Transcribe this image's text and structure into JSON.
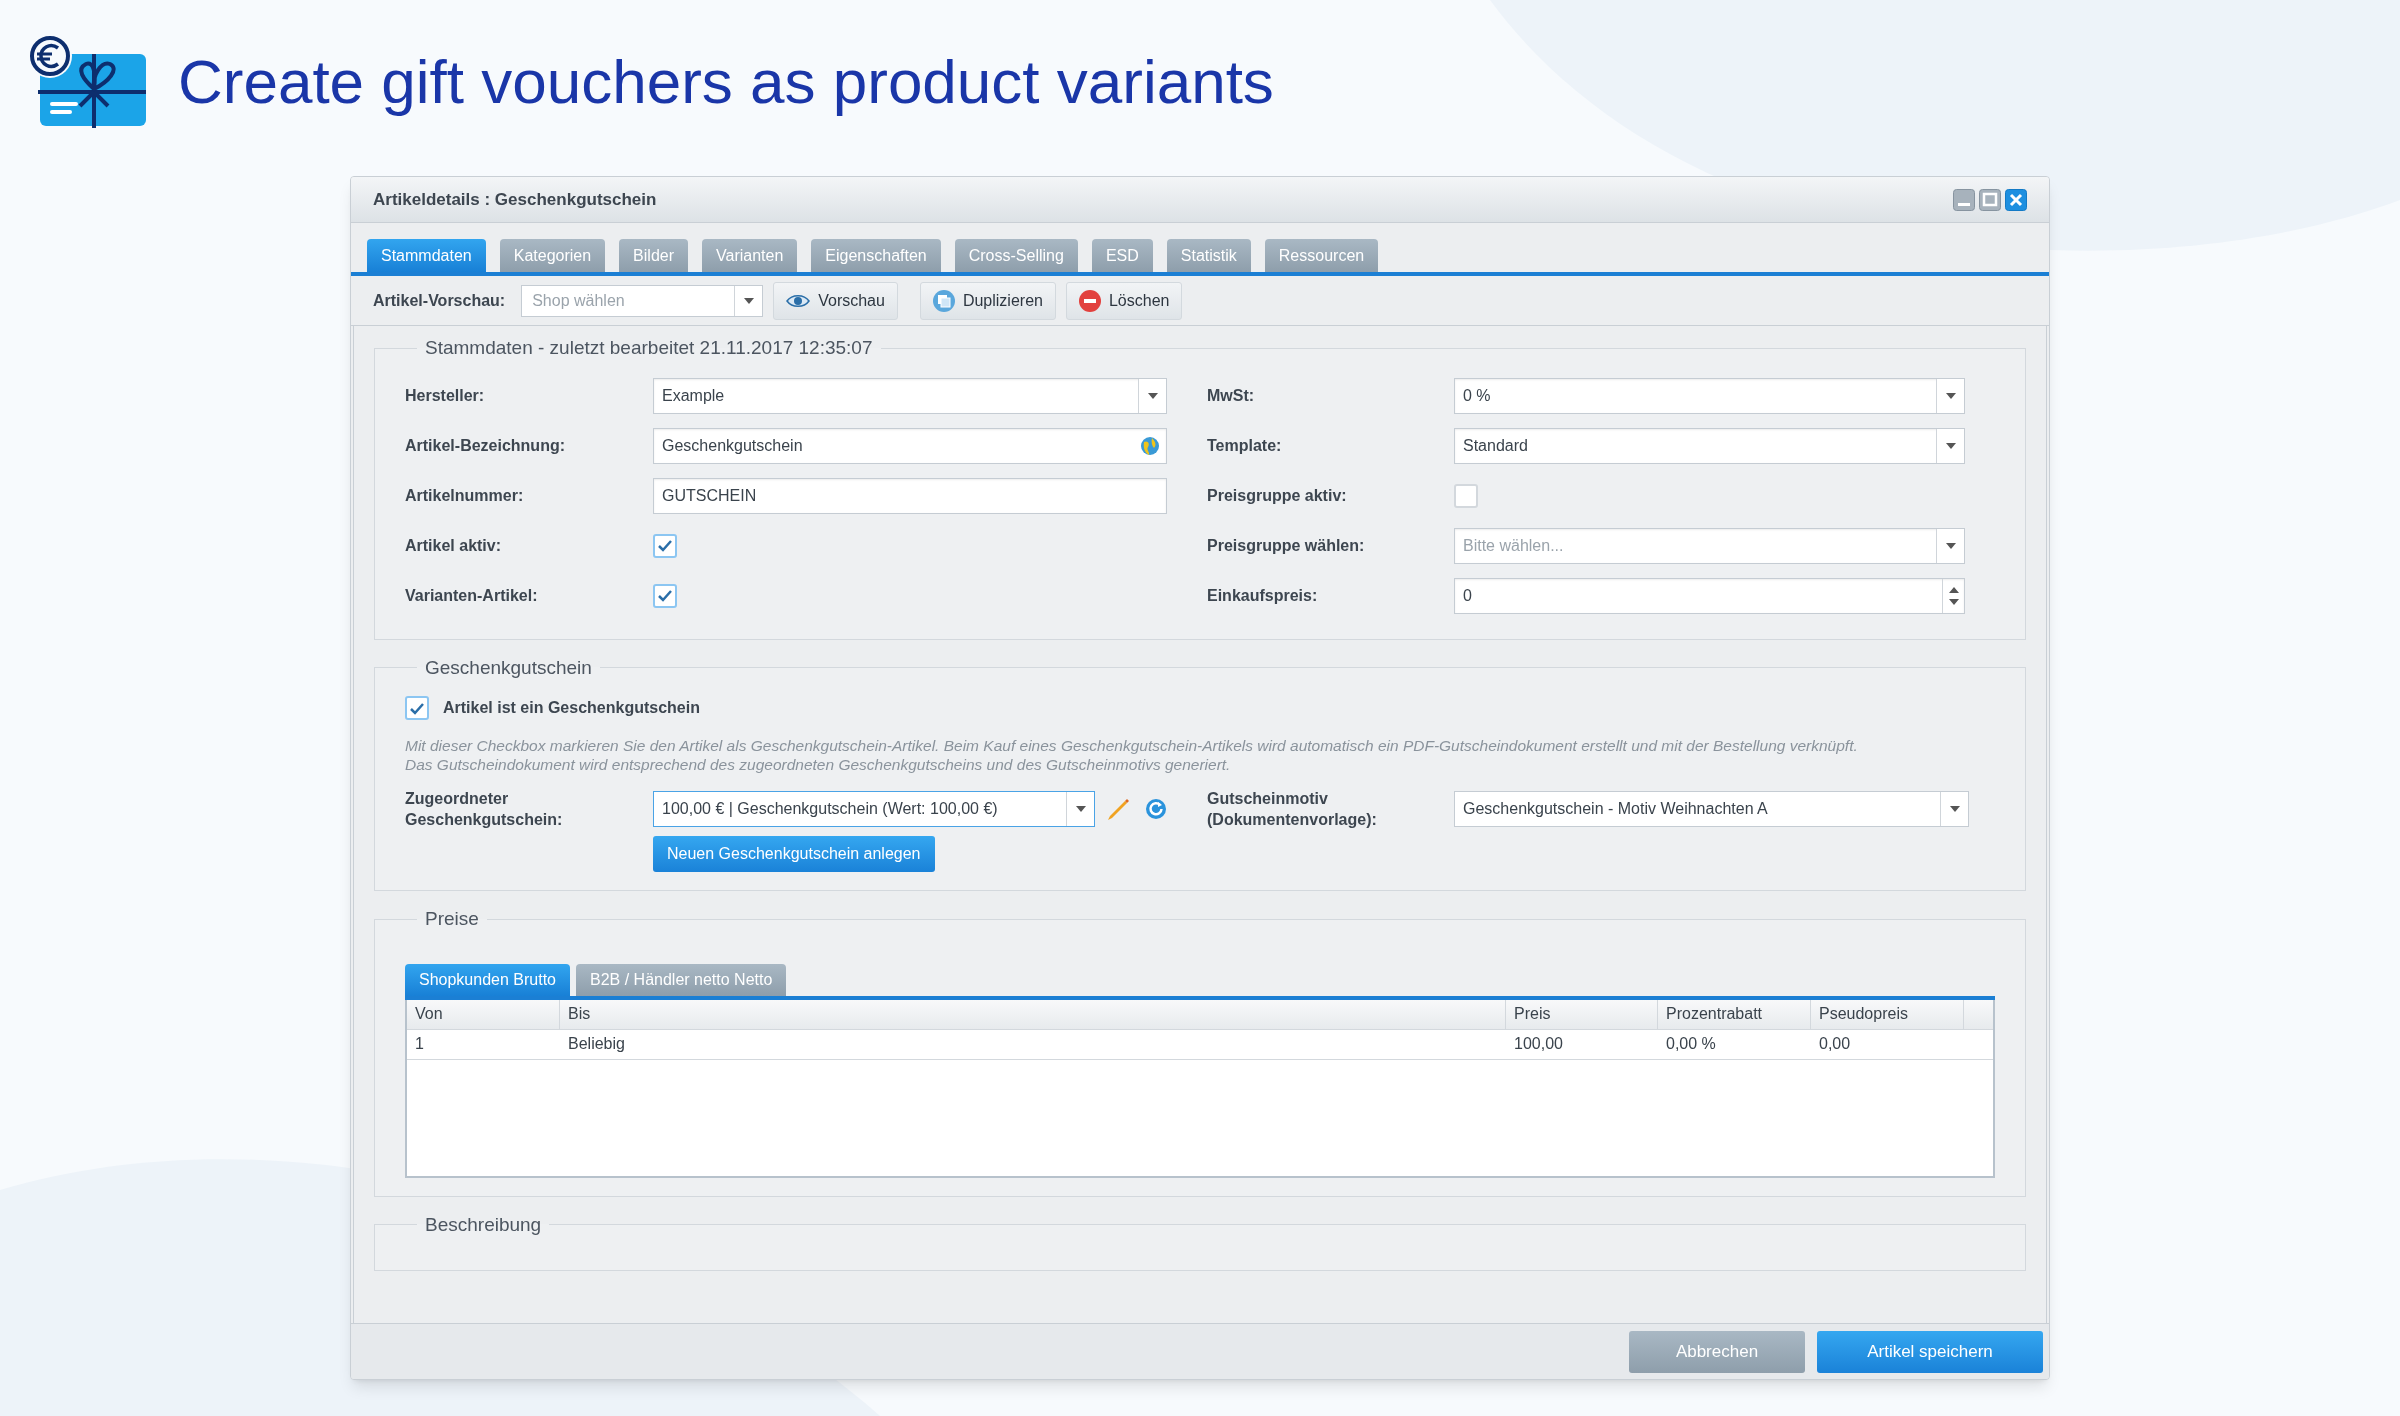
{
  "headline": {
    "title": "Create gift vouchers as product variants"
  },
  "window": {
    "title": "Artikeldetails : Geschenkgutschein"
  },
  "tabs": [
    {
      "label": "Stammdaten",
      "selected": true
    },
    {
      "label": "Kategorien",
      "selected": false
    },
    {
      "label": "Bilder",
      "selected": false
    },
    {
      "label": "Varianten",
      "selected": false
    },
    {
      "label": "Eigenschaften",
      "selected": false
    },
    {
      "label": "Cross-Selling",
      "selected": false
    },
    {
      "label": "ESD",
      "selected": false
    },
    {
      "label": "Statistik",
      "selected": false
    },
    {
      "label": "Ressourcen",
      "selected": false
    }
  ],
  "toolbar": {
    "label": "Artikel-Vorschau:",
    "shop_select": {
      "placeholder": "Shop wählen"
    },
    "buttons": [
      {
        "kind": "preview",
        "label": "Vorschau"
      },
      {
        "kind": "duplicate",
        "label": "Duplizieren"
      },
      {
        "kind": "delete",
        "label": "Löschen"
      }
    ]
  },
  "stammdaten": {
    "legend": "Stammdaten - zuletzt bearbeitet 21.11.2017 12:35:07",
    "left_fields": [
      {
        "kind": "select",
        "label": "Hersteller:",
        "value": "Example"
      },
      {
        "kind": "translatable",
        "label": "Artikel-Bezeichnung:",
        "value": "Geschenkgutschein"
      },
      {
        "kind": "text",
        "label": "Artikelnummer:",
        "value": "GUTSCHEIN"
      },
      {
        "kind": "checkbox",
        "label": "Artikel aktiv:",
        "checked": true
      },
      {
        "kind": "checkbox",
        "label": "Varianten-Artikel:",
        "checked": true
      }
    ],
    "right_fields": [
      {
        "kind": "select",
        "label": "MwSt:",
        "value": "0 %"
      },
      {
        "kind": "select",
        "label": "Template:",
        "value": "Standard"
      },
      {
        "kind": "checkbox",
        "label": "Preisgruppe aktiv:",
        "checked": false
      },
      {
        "kind": "select",
        "label": "Preisgruppe wählen:",
        "placeholder": "Bitte wählen..."
      },
      {
        "kind": "number",
        "label": "Einkaufspreis:",
        "value": "0"
      }
    ]
  },
  "gift_voucher": {
    "legend": "Geschenkgutschein",
    "checkbox": {
      "label": "Artikel ist ein Geschenkgutschein",
      "checked": true
    },
    "hint": "Mit dieser Checkbox markieren Sie den Artikel als Geschenkgutschein-Artikel. Beim Kauf eines Geschenkgutschein-Artikels wird automatisch ein PDF-Gutscheindokument erstellt und mit der Bestellung verknüpft.\nDas Gutscheindokument wird entsprechend des zugeordneten Geschenkgutscheins und des Gutscheinmotivs generiert.",
    "assigned": {
      "label": "Zugeordneter\nGeschenkgutschein:",
      "value": "100,00 € | Geschenkgutschein (Wert: 100,00 €)"
    },
    "new_button": "Neuen Geschenkgutschein anlegen",
    "motif": {
      "label": "Gutscheinmotiv\n(Dokumentenvorlage):",
      "value": "Geschenkgutschein - Motiv Weihnachten A"
    }
  },
  "prices": {
    "legend": "Preise",
    "tabs": [
      {
        "label": "Shopkunden Brutto",
        "selected": true
      },
      {
        "label": "B2B / Händler netto Netto",
        "selected": false
      }
    ],
    "columns": [
      "Von",
      "Bis",
      "Preis",
      "Prozentrabatt",
      "Pseudopreis"
    ],
    "rows": [
      [
        "1",
        "Beliebig",
        "100,00",
        "0,00 %",
        "0,00"
      ]
    ]
  },
  "description": {
    "legend": "Beschreibung"
  },
  "footer_buttons": [
    {
      "kind": "secondary",
      "label": "Abbrechen"
    },
    {
      "kind": "primary",
      "label": "Artikel speichern"
    }
  ]
}
